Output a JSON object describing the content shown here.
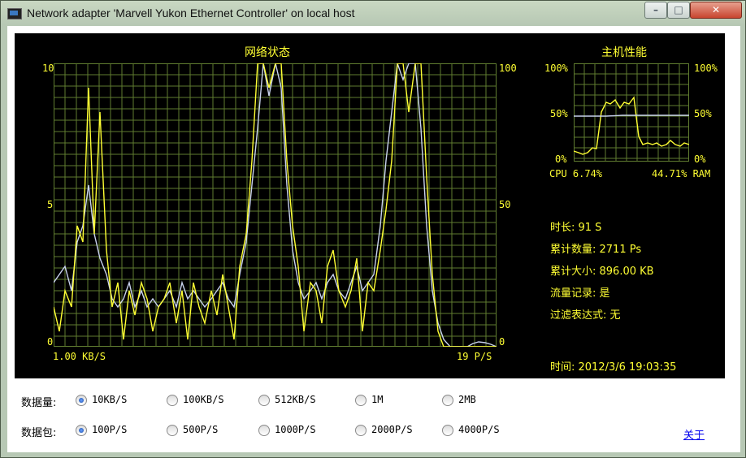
{
  "window": {
    "title": "Network adapter 'Marvell Yukon Ethernet Controller' on local host"
  },
  "network": {
    "title": "网络状态",
    "left_axis_ticks": [
      "10",
      "5",
      "0"
    ],
    "right_axis_ticks": [
      "100",
      "50",
      "0"
    ],
    "left_unit": "1.00 KB/S",
    "right_unit": "19 P/S",
    "colors": {
      "bytes": "#ffff33",
      "packets": "#c8d2ee",
      "grid": "#607c30"
    }
  },
  "host": {
    "title": "主机性能",
    "left_ticks": [
      "100%",
      "50%",
      "0%"
    ],
    "right_ticks": [
      "100%",
      "50%",
      "0%"
    ],
    "cpu_label": "CPU 6.74%",
    "ram_label": "44.71% RAM"
  },
  "stats": {
    "duration": "时长: 91 S",
    "count": "累计数量: 2711 Ps",
    "size": "累计大小: 896.00 KB",
    "logging": "流量记录: 是",
    "filter": "过滤表达式: 无",
    "time": "时间: 2012/3/6 19:03:35"
  },
  "controls": {
    "bytes_label": "数据量:",
    "packets_label": "数据包:",
    "bytes_options": [
      "10KB/S",
      "100KB/S",
      "512KB/S",
      "1M",
      "2MB"
    ],
    "bytes_selected": "10KB/S",
    "packets_options": [
      "100P/S",
      "500P/S",
      "1000P/S",
      "2000P/S",
      "4000P/S"
    ],
    "packets_selected": "100P/S",
    "about": "关于"
  }
}
